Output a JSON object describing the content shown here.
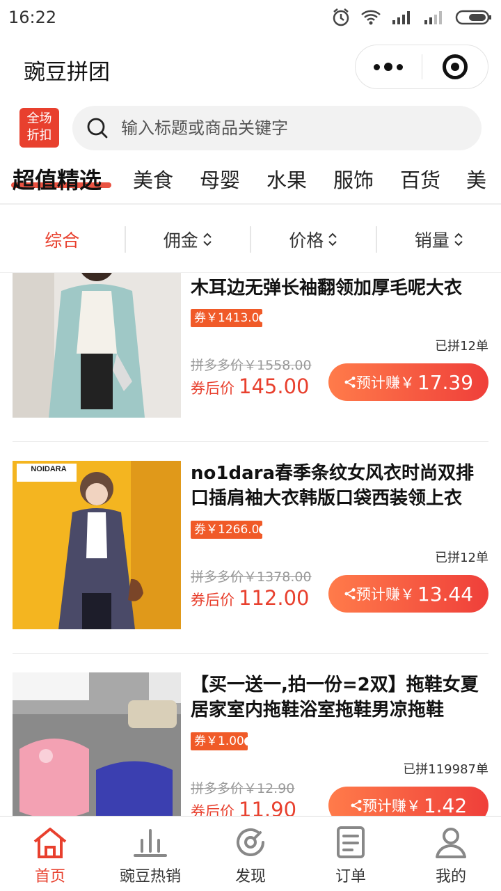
{
  "status_bar": {
    "time": "16:22"
  },
  "app": {
    "title": "豌豆拼团"
  },
  "discount_badge": {
    "line1": "全场",
    "line2": "折扣"
  },
  "search": {
    "placeholder": "输入标题或商品关键字"
  },
  "categories": [
    "超值精选",
    "美食",
    "母婴",
    "水果",
    "服饰",
    "百货",
    "美"
  ],
  "sort_options": [
    {
      "label": "综合",
      "active": true,
      "has_arrows": false
    },
    {
      "label": "佣金",
      "active": false,
      "has_arrows": true
    },
    {
      "label": "价格",
      "active": false,
      "has_arrows": true
    },
    {
      "label": "销量",
      "active": false,
      "has_arrows": true
    }
  ],
  "products": [
    {
      "name": "木耳边无弹长袖翻领加厚毛呢大衣",
      "coupon": "券￥1413.0",
      "sold": "已拼12单",
      "orig_price": "拼多多价￥1558.00",
      "after_label": "券后价",
      "after_price": "145.00",
      "earn_label": "预计赚￥",
      "earn_value": "17.39"
    },
    {
      "name": "no1dara春季条纹女风衣时尚双排口插肩袖大衣韩版口袋西装领上衣",
      "coupon": "券￥1266.0",
      "sold": "已拼12单",
      "orig_price": "拼多多价￥1378.00",
      "after_label": "券后价",
      "after_price": "112.00",
      "earn_label": "预计赚￥",
      "earn_value": "13.44",
      "brand_logo": "NOIDARA"
    },
    {
      "name": "【买一送一,拍一份=2双】拖鞋女夏居家室内拖鞋浴室拖鞋男凉拖鞋",
      "coupon": "券￥1.00",
      "sold": "已拼119987单",
      "orig_price": "拼多多价￥12.90",
      "after_label": "券后价",
      "after_price": "11.90",
      "earn_label": "预计赚￥",
      "earn_value": "1.42"
    }
  ],
  "tabs": [
    {
      "label": "首页",
      "icon": "home-icon",
      "active": true
    },
    {
      "label": "豌豆热销",
      "icon": "bar-chart-icon",
      "active": false
    },
    {
      "label": "发现",
      "icon": "discover-icon",
      "active": false
    },
    {
      "label": "订单",
      "icon": "order-icon",
      "active": false
    },
    {
      "label": "我的",
      "icon": "user-icon",
      "active": false
    }
  ],
  "colors": {
    "accent": "#e8402e",
    "coupon": "#f05a28",
    "earn_start": "#ff7b4a",
    "earn_end": "#ef3f3a"
  }
}
